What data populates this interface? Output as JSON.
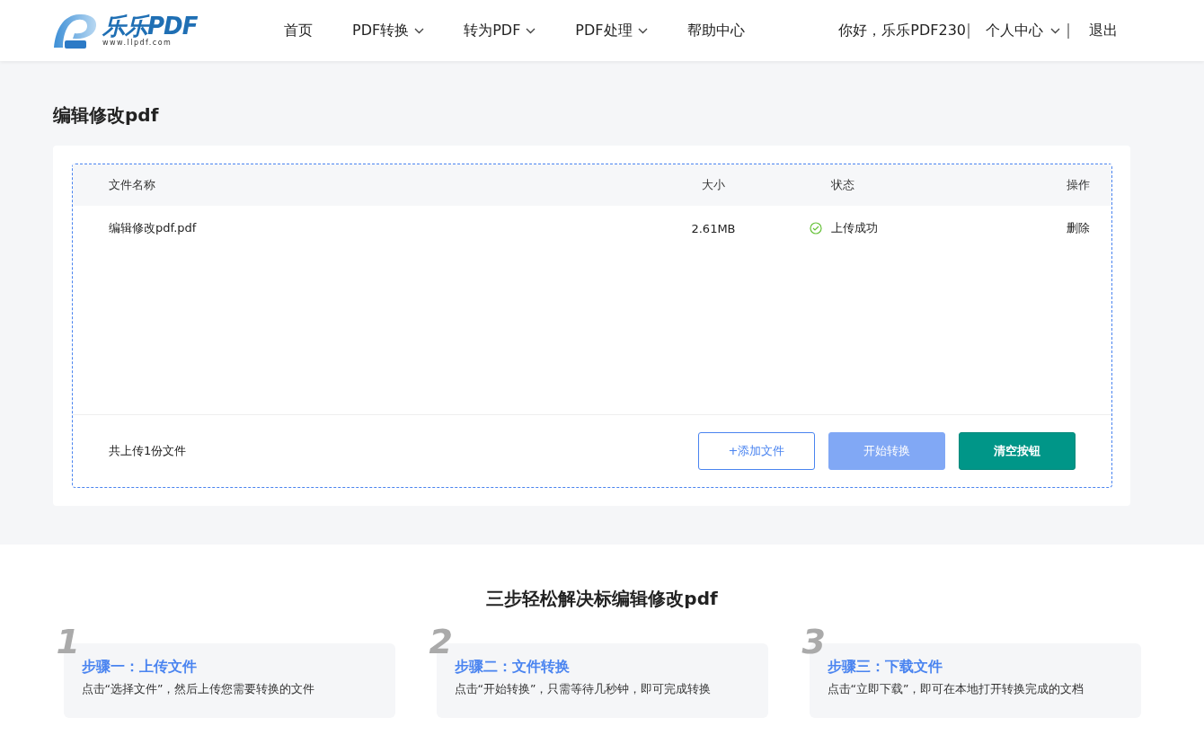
{
  "header": {
    "logo": {
      "name": "乐乐PDF",
      "url": "www.llpdf.com"
    },
    "nav": [
      {
        "label": "首页",
        "has_menu": false
      },
      {
        "label": "PDF转换",
        "has_menu": true
      },
      {
        "label": "转为PDF",
        "has_menu": true
      },
      {
        "label": "PDF处理",
        "has_menu": true
      },
      {
        "label": "帮助中心",
        "has_menu": false
      }
    ],
    "user": {
      "greeting": "你好，乐乐PDF230",
      "account": "个人中心",
      "logout": "退出"
    }
  },
  "page_title": "编辑修改pdf",
  "table": {
    "columns": [
      "文件名称",
      "大小",
      "状态",
      "操作"
    ],
    "rows": [
      {
        "name": "编辑修改pdf.pdf",
        "size": "2.61MB",
        "status": {
          "kind": "success",
          "text": "上传成功"
        },
        "action": "删除"
      }
    ]
  },
  "footer": {
    "summary": "共上传1份文件",
    "buttons": [
      {
        "label": "+添加文件",
        "kind": "outline",
        "disabled": false
      },
      {
        "label": "开始转换",
        "kind": "primary",
        "disabled": true
      },
      {
        "label": "清空按钮",
        "kind": "teal",
        "disabled": false
      }
    ]
  },
  "steps_title": "三步轻松解决标编辑修改pdf",
  "steps": [
    {
      "number": "1",
      "title": "步骤一：上传文件",
      "text": "点击“选择文件”，然后上传您需要转换的文件"
    },
    {
      "number": "2",
      "title": "步骤二：文件转换",
      "text": "点击“开始转换”，只需等待几秒钟，即可完成转换"
    },
    {
      "number": "3",
      "title": "步骤三：下载文件",
      "text": "点击“立即下载”，即可在本地打开转换完成的文档"
    }
  ]
}
